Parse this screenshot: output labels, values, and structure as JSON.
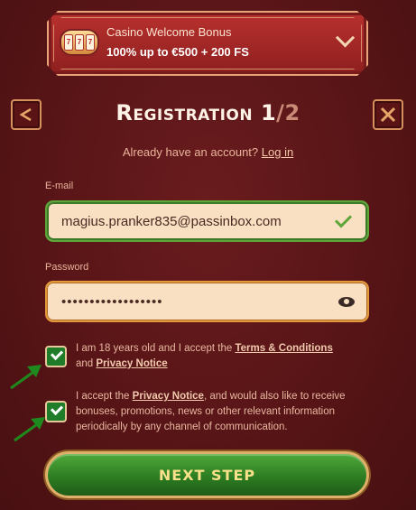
{
  "bonus": {
    "title": "Casino Welcome Bonus",
    "subtitle": "100% up to €500 + 200 FS",
    "icon": "slot-machine-icon"
  },
  "header": {
    "title": "Registration",
    "step_current": "1",
    "step_total": "/2",
    "back_icon": "back-arrow-icon",
    "close_icon": "close-icon"
  },
  "login_prompt": {
    "text": "Already have an account?",
    "link": "Log in"
  },
  "email": {
    "label": "E-mail",
    "value": "magius.pranker835@passinbox.com"
  },
  "password": {
    "label": "Password",
    "value": "••••••••••••••••••"
  },
  "consent1": {
    "pre": "I am 18 years old and I accept the",
    "link1": "Terms & Conditions",
    "mid": "and",
    "link2": "Privacy Notice",
    "checked": true
  },
  "consent2": {
    "pre": "I accept the",
    "link": "Privacy Notice",
    "post": ", and would also like to receive bonuses, promotions, news or other relevant information periodically by any channel of communication.",
    "checked": true
  },
  "next_button": "NEXT STEP",
  "colors": {
    "background": "#561416",
    "accent_gold": "#e0b06a",
    "success_green": "#2d7d22"
  }
}
